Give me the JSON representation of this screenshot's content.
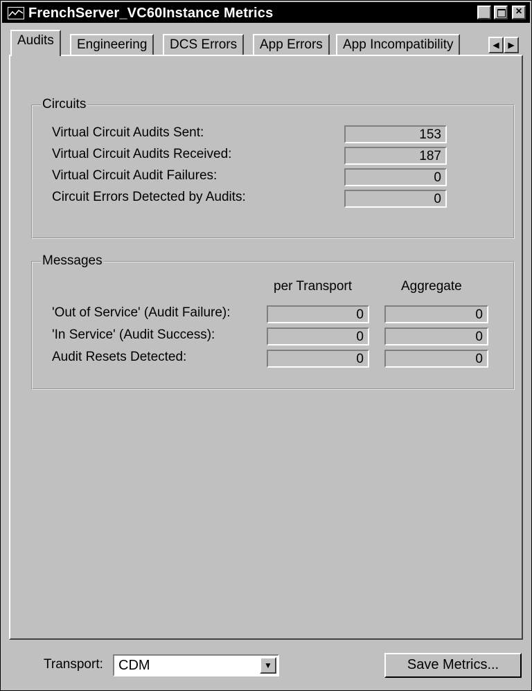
{
  "window": {
    "title": "FrenchServer_VC60Instance Metrics"
  },
  "tabs": [
    "Audits",
    "Engineering",
    "DCS Errors",
    "App Errors",
    "App Incompatibility"
  ],
  "circuits": {
    "title": "Circuits",
    "rows": [
      {
        "label": "Virtual Circuit Audits Sent:",
        "value": "153"
      },
      {
        "label": "Virtual Circuit Audits Received:",
        "value": "187"
      },
      {
        "label": "Virtual Circuit Audit Failures:",
        "value": "0"
      },
      {
        "label": "Circuit Errors Detected by Audits:",
        "value": "0"
      }
    ]
  },
  "messages": {
    "title": "Messages",
    "col_per_transport": "per Transport",
    "col_aggregate": "Aggregate",
    "rows": [
      {
        "label": "'Out of Service' (Audit Failure):",
        "per_transport": "0",
        "aggregate": "0"
      },
      {
        "label": "'In Service' (Audit Success):",
        "per_transport": "0",
        "aggregate": "0"
      },
      {
        "label": "Audit Resets Detected:",
        "per_transport": "0",
        "aggregate": "0"
      }
    ]
  },
  "bottom": {
    "transport_label": "Transport:",
    "transport_value": "CDM",
    "save_button": "Save Metrics..."
  }
}
